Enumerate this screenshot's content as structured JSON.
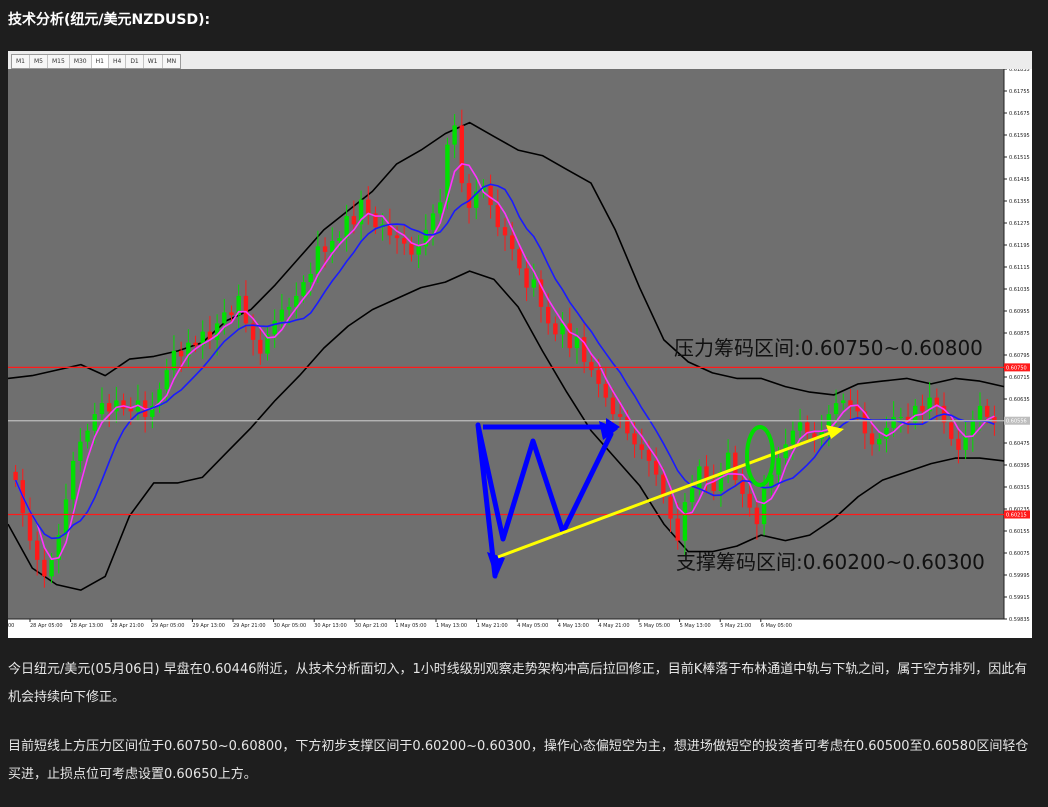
{
  "page": {
    "title": "技术分析(纽元/美元NZDUSD):",
    "paragraphs": [
      "今日纽元/美元(05月06日) 早盘在0.60446附近，从技术分析面切入，1小时线级别观察走势架构冲高后拉回修正，目前K棒落于布林通道中轨与下轨之间，属于空方排列，因此有机会持续向下修正。",
      "目前短线上方压力区间位于0.60750~0.60800，下方初步支撑区间于0.60200~0.60300，操作心态偏短空为主，想进场做短空的投资者可考虑在0.60500至0.60580区间轻仓买进，止损点位可考虑设置0.60650上方。"
    ]
  },
  "toolbar": {
    "timeframes": [
      "M1",
      "M5",
      "M15",
      "M30",
      "H1",
      "H4",
      "D1",
      "W1",
      "MN"
    ],
    "active": "H1"
  },
  "chart_data": {
    "type": "candlestick",
    "symbol": "NZDUSD",
    "timeframe": "H1",
    "ylim": [
      0.59835,
      0.61835
    ],
    "y_ticks": [
      "0.61835",
      "0.61755",
      "0.61675",
      "0.61595",
      "0.61515",
      "0.61435",
      "0.61355",
      "0.61275",
      "0.61195",
      "0.61115",
      "0.61035",
      "0.60955",
      "0.60875",
      "0.60795",
      "0.60715",
      "0.60635",
      "0.60555",
      "0.60475",
      "0.60395",
      "0.60315",
      "0.60235",
      "0.60155",
      "0.60075",
      "0.59995",
      "0.59915",
      "0.59835"
    ],
    "x_ticks": [
      "28 Apr 05:00",
      "28 Apr 13:00",
      "28 Apr 21:00",
      "29 Apr 05:00",
      "29 Apr 13:00",
      "29 Apr 21:00",
      "30 Apr 05:00",
      "30 Apr 13:00",
      "30 Apr 21:00",
      "1 May 05:00",
      "1 May 13:00",
      "1 May 21:00",
      "4 May 05:00",
      "4 May 13:00",
      "4 May 21:00",
      "5 May 05:00",
      "5 May 13:00",
      "5 May 21:00",
      "6 May 05:00"
    ],
    "x_tick_first": "00",
    "close_series": [
      0.6034,
      0.6022,
      0.6012,
      0.6005,
      0.5999,
      0.6005,
      0.6014,
      0.6027,
      0.6041,
      0.6048,
      0.6052,
      0.6058,
      0.6062,
      0.6059,
      0.6063,
      0.606,
      0.6059,
      0.6063,
      0.6057,
      0.6061,
      0.6067,
      0.6074,
      0.6081,
      0.6079,
      0.6084,
      0.6083,
      0.6088,
      0.6085,
      0.6091,
      0.6095,
      0.6094,
      0.6101,
      0.6091,
      0.6085,
      0.608,
      0.6087,
      0.6092,
      0.6096,
      0.6097,
      0.6101,
      0.6106,
      0.6109,
      0.6119,
      0.6117,
      0.6121,
      0.6122,
      0.613,
      0.6127,
      0.6136,
      0.6131,
      0.6126,
      0.6127,
      0.6123,
      0.6122,
      0.612,
      0.6116,
      0.6119,
      0.6125,
      0.6131,
      0.6135,
      0.6156,
      0.6163,
      0.6142,
      0.6133,
      0.6139,
      0.6141,
      0.6134,
      0.6126,
      0.6123,
      0.6118,
      0.6111,
      0.6104,
      0.6107,
      0.6097,
      0.6091,
      0.6087,
      0.6091,
      0.6082,
      0.6086,
      0.6077,
      0.6074,
      0.6069,
      0.6064,
      0.6058,
      0.6057,
      0.6051,
      0.6047,
      0.6045,
      0.6041,
      0.6036,
      0.6028,
      0.602,
      0.6012,
      0.6026,
      0.6031,
      0.6039,
      0.6034,
      0.603,
      0.6037,
      0.6044,
      0.6034,
      0.6029,
      0.6024,
      0.6018,
      0.6031,
      0.6036,
      0.6042,
      0.6047,
      0.6052,
      0.6055,
      0.6051,
      0.6049,
      0.6052,
      0.6058,
      0.6062,
      0.6063,
      0.6061,
      0.6059,
      0.6051,
      0.6047,
      0.6049,
      0.6053,
      0.6057,
      0.6057,
      0.6055,
      0.6061,
      0.6059,
      0.6064,
      0.6061,
      0.6055,
      0.6049,
      0.6045,
      0.605,
      0.6056,
      0.6061,
      0.6057,
      0.6055
    ],
    "bollinger": {
      "upper": [
        0.6071,
        0.6072,
        0.6074,
        0.6076,
        0.6072,
        0.6078,
        0.6079,
        0.6081,
        0.6084,
        0.6092,
        0.6096,
        0.6105,
        0.6115,
        0.6125,
        0.6132,
        0.6139,
        0.6149,
        0.6154,
        0.616,
        0.6164,
        0.6159,
        0.6154,
        0.6152,
        0.6147,
        0.6142,
        0.6125,
        0.6104,
        0.6085,
        0.6077,
        0.6073,
        0.6071,
        0.6071,
        0.6068,
        0.6066,
        0.6065,
        0.6069,
        0.607,
        0.6071,
        0.6069,
        0.6071,
        0.607,
        0.6068
      ],
      "middle": [
        0.6046,
        0.6037,
        0.6028,
        0.6033,
        0.6046,
        0.6054,
        0.6055,
        0.6055,
        0.606,
        0.607,
        0.6076,
        0.6084,
        0.6092,
        0.6101,
        0.6108,
        0.6116,
        0.612,
        0.6127,
        0.6131,
        0.6135,
        0.6129,
        0.6121,
        0.6115,
        0.6107,
        0.6094,
        0.6083,
        0.6071,
        0.6056,
        0.6044,
        0.6038,
        0.603,
        0.6025,
        0.6031,
        0.6035,
        0.6043,
        0.6052,
        0.6058,
        0.606,
        0.6056,
        0.6058,
        0.6056,
        0.6054
      ],
      "lower": [
        0.6018,
        0.6002,
        0.5996,
        0.5994,
        0.5999,
        0.6021,
        0.6033,
        0.6033,
        0.6035,
        0.6044,
        0.6053,
        0.6063,
        0.6072,
        0.6082,
        0.609,
        0.6096,
        0.61,
        0.6104,
        0.6106,
        0.611,
        0.6107,
        0.6097,
        0.6081,
        0.6066,
        0.6052,
        0.6042,
        0.6032,
        0.6018,
        0.6008,
        0.6008,
        0.601,
        0.6014,
        0.6012,
        0.6014,
        0.602,
        0.6028,
        0.6034,
        0.6037,
        0.604,
        0.6042,
        0.6042,
        0.6041
      ]
    },
    "horizontal_lines": [
      {
        "value": 0.6075,
        "label": "0.60750",
        "color": "#ff1a1a"
      },
      {
        "value": 0.60215,
        "label": "0.60215",
        "color": "#ff1a1a"
      },
      {
        "value": 0.60556,
        "label": "0.60556",
        "color": "#bdbdbd"
      }
    ],
    "annotations": {
      "resistance_text": "压力筹码区间:0.60750~0.60800",
      "support_text": "支撑筹码区间:0.60200~0.60300"
    },
    "colors": {
      "background": "#6f6f6f",
      "bull": "#00e000",
      "bear": "#ff1a1a",
      "ma_fast": "#ff33ff",
      "ma_mid": "#1a1aff",
      "bands": "#000000",
      "trendline": "#ffff00",
      "pattern": "#0000ff",
      "circle": "#00dd00"
    }
  }
}
